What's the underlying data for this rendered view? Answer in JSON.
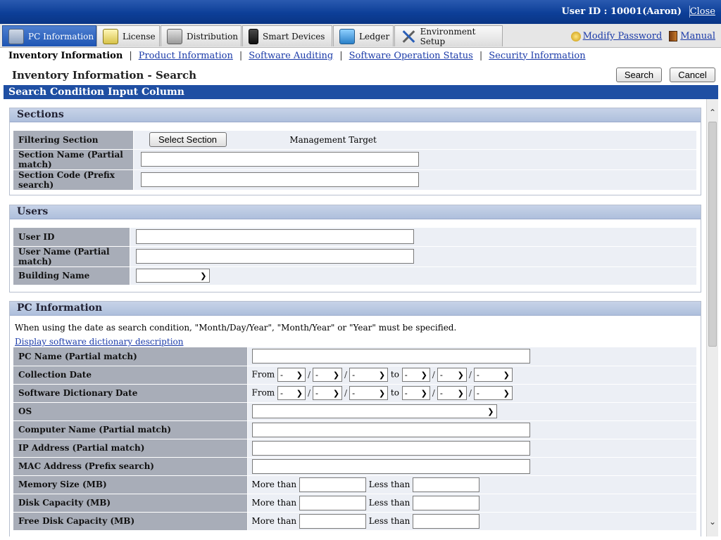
{
  "topbar": {
    "user_id": "User ID : 10001(Aaron)",
    "close_label": "Close"
  },
  "tabs": [
    {
      "label": "PC Information",
      "icon": "pc-icon"
    },
    {
      "label": "License",
      "icon": "license-icon"
    },
    {
      "label": "Distribution",
      "icon": "distribution-icon"
    },
    {
      "label": "Smart Devices",
      "icon": "smart-device-icon"
    },
    {
      "label": "Ledger",
      "icon": "ledger-icon"
    },
    {
      "label": "Environment Setup",
      "icon": "tools-icon"
    }
  ],
  "toplinks": {
    "modify_password": "Modify Password",
    "manual": "Manual"
  },
  "subnav": {
    "current": "Inventory Information",
    "links": [
      "Product Information",
      "Software Auditing",
      "Software Operation Status",
      "Security Information"
    ]
  },
  "page": {
    "title": "Inventory Information - Search",
    "search_label": "Search",
    "cancel_label": "Cancel"
  },
  "panel_title": "Search Condition Input Column",
  "sections": {
    "title": "Sections",
    "filtering_label": "Filtering Section",
    "select_button": "Select Section",
    "filtering_value": "Management Target",
    "name_label": "Section Name (Partial match)",
    "code_label": "Section Code (Prefix search)"
  },
  "users": {
    "title": "Users",
    "id_label": "User ID",
    "name_label": "User Name (Partial match)",
    "building_label": "Building Name"
  },
  "pc": {
    "title": "PC Information",
    "note": "When using the date as search condition, \"Month/Day/Year\", \"Month/Year\" or \"Year\" must be specified.",
    "dict_link": "Display software dictionary description",
    "pc_name_label": "PC Name (Partial match)",
    "collection_date_label": "Collection Date",
    "dict_date_label": "Software Dictionary Date",
    "from": "From",
    "to": "to",
    "dash": "-",
    "os_label": "OS",
    "computer_name_label": "Computer Name (Partial match)",
    "ip_label": "IP Address (Partial match)",
    "mac_label": "MAC Address (Prefix search)",
    "memory_label": "Memory Size (MB)",
    "disk_label": "Disk Capacity (MB)",
    "free_disk_label": "Free Disk Capacity (MB)",
    "more_than": "More than",
    "less_than": "Less than"
  }
}
